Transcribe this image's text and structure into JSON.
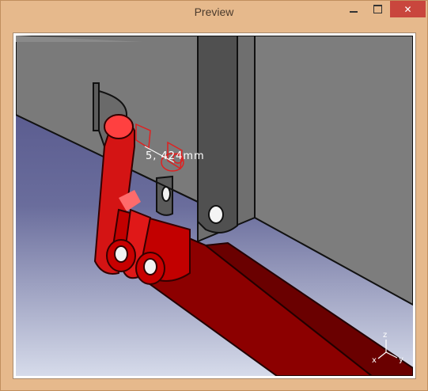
{
  "window": {
    "title": "Preview",
    "controls": {
      "minimize": "minimize",
      "maximize": "maximize",
      "close": "✕"
    }
  },
  "viewport": {
    "measurement_label": "5, 424mm",
    "axes": {
      "z": "z",
      "x": "x",
      "y": "y"
    },
    "colors": {
      "background_top": "#5a5a8c",
      "background_bottom": "#cdd3e8",
      "housing": "#7b7b7b",
      "part_red": "#e11010",
      "part_dark_red": "#8a0000",
      "annotation_red": "#e02020"
    }
  }
}
